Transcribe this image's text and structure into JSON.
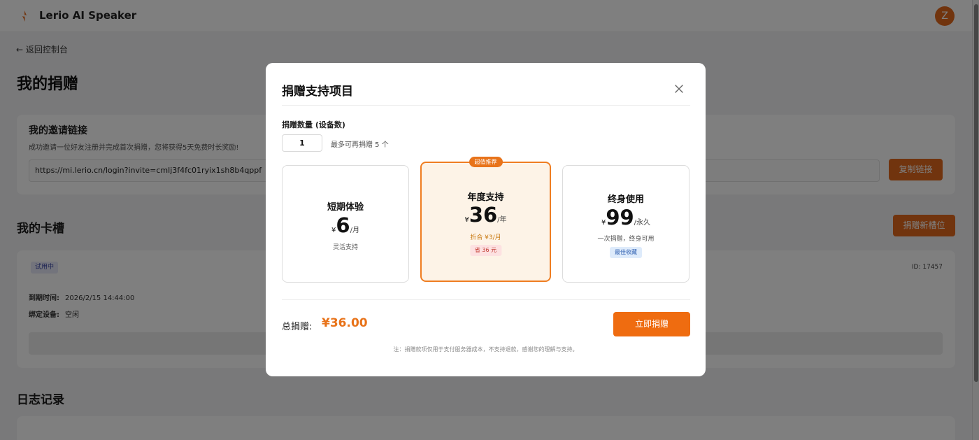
{
  "app": {
    "title": "Lerio AI Speaker",
    "avatar_letter": "Z"
  },
  "page": {
    "back_label": "← 返回控制台",
    "title": "我的捐赠"
  },
  "invite": {
    "title": "我的邀请链接",
    "description": "成功邀请一位好友注册并完成首次捐赠，您将获得5天免费时长奖励!",
    "link": "https://mi.lerio.cn/login?invite=cmlj3f4fc01ryix1sh8b4qppf",
    "copy_label": "复制链接"
  },
  "slots": {
    "title": "我的卡槽",
    "new_slot_label": "捐赠新槽位",
    "items": [
      {
        "status": "试用中",
        "id": "ID: 17457",
        "expiry_label": "到期时间:",
        "expiry_value": "2026/2/15 14:44:00",
        "device_label": "绑定设备:",
        "device_value": "空闲"
      }
    ]
  },
  "logs": {
    "title": "日志记录"
  },
  "modal": {
    "title": "捐赠支持项目",
    "qty_label": "捐赠数量 (设备数)",
    "qty_value": "1",
    "qty_hint": "最多可再捐赠 5 个",
    "plans": [
      {
        "name": "短期体验",
        "currency": "¥",
        "price": "6",
        "unit": "/月",
        "sub": "灵活支持"
      },
      {
        "name": "年度支持",
        "currency": "¥",
        "price": "36",
        "unit": "/年",
        "sub": "折合 ¥3/月",
        "tag": "省 36 元",
        "ribbon": "超值推荐",
        "selected": true
      },
      {
        "name": "终身使用",
        "currency": "¥",
        "price": "99",
        "unit": "/永久",
        "sub": "一次捐赠，终身可用",
        "tag": "最佳收藏"
      }
    ],
    "total_label": "总捐赠:",
    "total_value": "¥36.00",
    "donate_label": "立即捐赠",
    "note": "注：捐赠款项仅用于支付服务器成本，不支持退款，感谢您的理解与支持。"
  },
  "colors": {
    "accent": "#ef6c10",
    "selected_border": "#ef7d21",
    "selected_bg": "#fdf3e7"
  }
}
